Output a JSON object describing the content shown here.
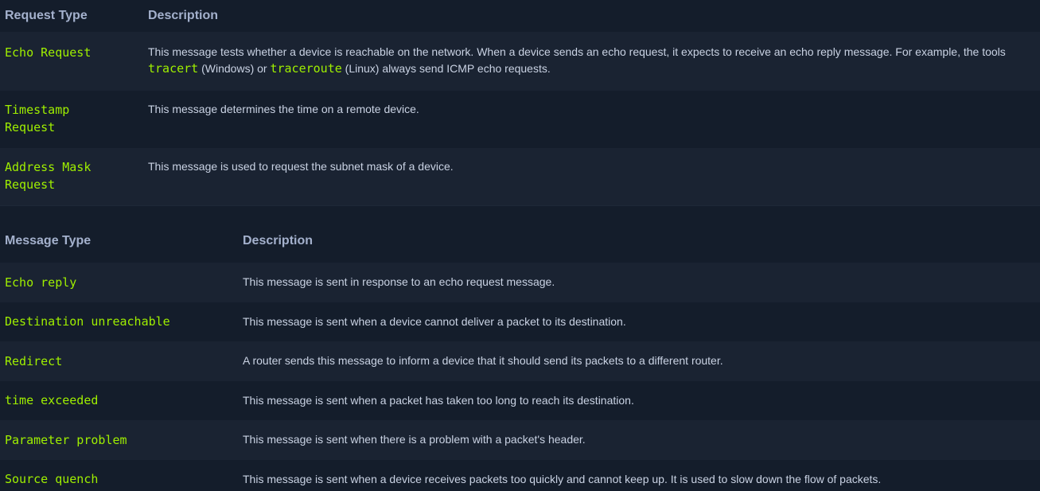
{
  "request_table": {
    "headers": [
      "Request Type",
      "Description"
    ],
    "rows": [
      {
        "type": "Echo Request",
        "desc_parts": {
          "a": "This message tests whether a device is reachable on the network. When a device sends an echo request, it expects to receive an echo reply message. For example, the tools ",
          "code1": "tracert",
          "b": " (Windows) or ",
          "code2": "traceroute",
          "c": " (Linux) always send ICMP echo requests."
        }
      },
      {
        "type_line1": "Timestamp",
        "type_line2": "Request",
        "desc": "This message determines the time on a remote device."
      },
      {
        "type_line1": "Address Mask",
        "type_line2": "Request",
        "desc": "This message is used to request the subnet mask of a device."
      }
    ]
  },
  "message_table": {
    "headers": [
      "Message Type",
      "Description"
    ],
    "rows": [
      {
        "type": "Echo reply",
        "desc": "This message is sent in response to an echo request message."
      },
      {
        "type": "Destination unreachable",
        "desc": "This message is sent when a device cannot deliver a packet to its destination."
      },
      {
        "type": "Redirect",
        "desc": "A router sends this message to inform a device that it should send its packets to a different router."
      },
      {
        "type": "time exceeded",
        "desc": "This message is sent when a packet has taken too long to reach its destination."
      },
      {
        "type": "Parameter problem",
        "desc": "This message is sent when there is a problem with a packet's header."
      },
      {
        "type": "Source quench",
        "desc": "This message is sent when a device receives packets too quickly and cannot keep up. It is used to slow down the flow of packets."
      }
    ]
  },
  "colors": {
    "background": "#141d2b",
    "row_alt": "#1a2332",
    "header_text": "#a4b1cd",
    "code_green": "#9fef00",
    "body_text": "#c9d2e3"
  }
}
